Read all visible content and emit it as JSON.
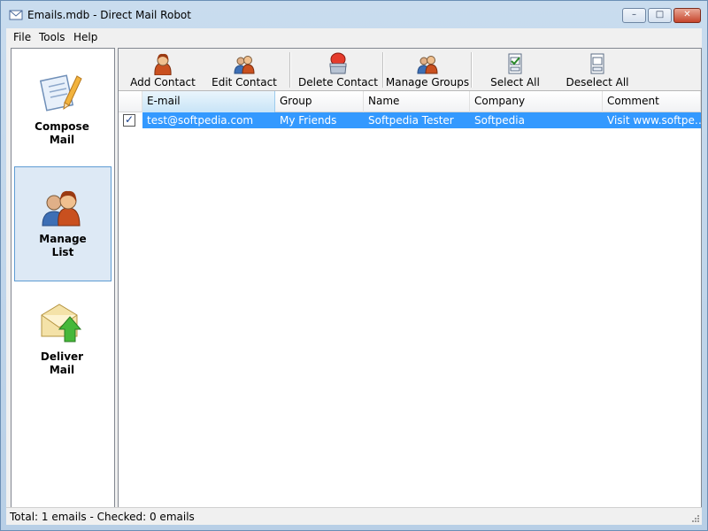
{
  "window": {
    "title": "Emails.mdb - Direct Mail Robot",
    "controls": {
      "minimize": "–",
      "maximize": "□",
      "close": "✕"
    }
  },
  "menu": [
    "File",
    "Tools",
    "Help"
  ],
  "sidebar": {
    "items": [
      {
        "label_line1": "Compose",
        "label_line2": "Mail",
        "icon": "compose-mail-icon",
        "active": false
      },
      {
        "label_line1": "Manage",
        "label_line2": "List",
        "icon": "manage-list-icon",
        "active": true
      },
      {
        "label_line1": "Deliver",
        "label_line2": "Mail",
        "icon": "deliver-mail-icon",
        "active": false
      }
    ]
  },
  "toolbar": {
    "add_contact": "Add Contact",
    "edit_contact": "Edit Contact",
    "delete_contact": "Delete Contact",
    "manage_groups": "Manage Groups",
    "select_all": "Select All",
    "deselect_all": "Deselect All"
  },
  "table": {
    "columns": [
      "E-mail",
      "Group",
      "Name",
      "Company",
      "Comment"
    ],
    "sorted_column": "E-mail",
    "rows": [
      {
        "checked": true,
        "selected": true,
        "email": "test@softpedia.com",
        "group": "My Friends",
        "name": "Softpedia Tester",
        "company": "Softpedia",
        "comment": "Visit www.softpe…"
      }
    ]
  },
  "status": {
    "text": "Total: 1 emails - Checked: 0 emails"
  },
  "colors": {
    "selection": "#3399ff",
    "active_nav_bg": "#dde9f5",
    "active_nav_border": "#5f9cd3"
  }
}
